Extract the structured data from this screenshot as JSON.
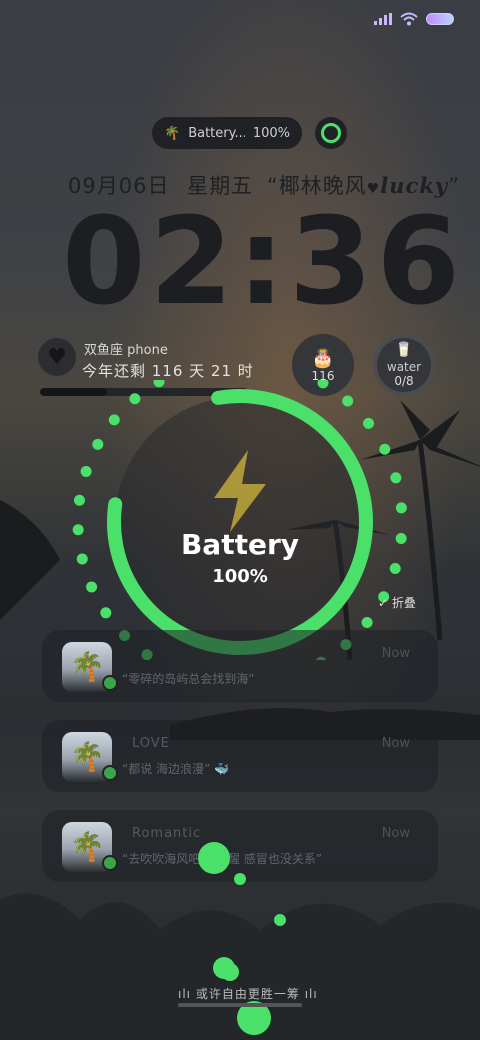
{
  "status_bar": {
    "signal": "signal-icon",
    "wifi": "wifi-icon",
    "battery": "battery-icon"
  },
  "pill": {
    "label": "Battery...",
    "value": "100%"
  },
  "date_line": {
    "date": "09月06日",
    "weekday": "星期五",
    "quote_open": "“",
    "quote_text": "椰林晚风",
    "heart": "♥",
    "lucky": "lucky",
    "quote_close": "”"
  },
  "clock": {
    "time": "02:36"
  },
  "countdown": {
    "zodiac": "双鱼座 phone",
    "remaining": "今年还剩 116 天 21 时",
    "progress": 0.32
  },
  "widgets": {
    "cake_value": "116",
    "water_label": "water",
    "water_value": "0/8"
  },
  "battery": {
    "label": "Battery",
    "percent": "100%",
    "level": 1.0,
    "accent": "#4be06a"
  },
  "fold": {
    "label": "折叠"
  },
  "notifications": [
    {
      "title": "",
      "message": "“零碎的岛屿总会找到海”",
      "time": "Now"
    },
    {
      "title": "LOVE",
      "message": "“都说 海边浪漫” 🐳",
      "time": "Now"
    },
    {
      "title": "Romantic",
      "message": "“去吹吹海风吧 能清醒 感冒也没关系”",
      "time": "Now"
    }
  ],
  "footer": {
    "text": "或许自由更胜一筹"
  }
}
